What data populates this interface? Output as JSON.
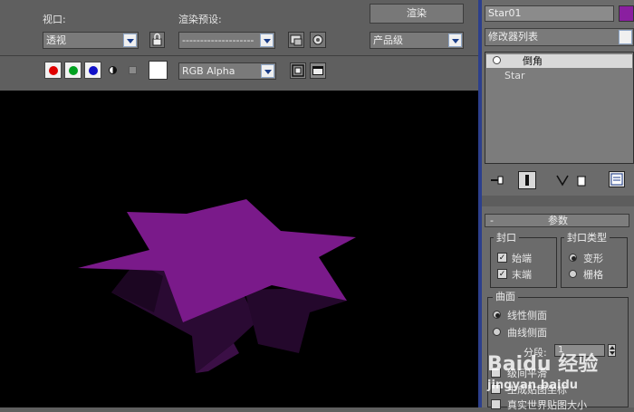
{
  "render_frame": {
    "viewport_label": "视口:",
    "viewport_value": "透视",
    "preset_label": "渲染预设:",
    "preset_value": "--------------------",
    "render_button": "渲染",
    "quality_value": "产品级",
    "channel_value": "RGB Alpha"
  },
  "command_panel": {
    "object_name": "Star01",
    "object_color": "#8a1fa0",
    "modifier_list": "修改器列表",
    "stack_items": [
      {
        "label": "倒角",
        "selected": true
      },
      {
        "label": "Star",
        "selected": false
      }
    ],
    "rollout_minus": "-",
    "rollout_title": "参数",
    "cap_group": {
      "title": "封口",
      "start": "始端",
      "end": "末端",
      "start_checked": true,
      "end_checked": true
    },
    "cap_type_group": {
      "title": "封口类型",
      "morph": "变形",
      "grid": "栅格",
      "selected": "morph"
    },
    "surface_group": {
      "title": "曲面",
      "linear": "线性侧面",
      "curved": "曲线侧面",
      "selected": "linear"
    },
    "segments_label": "分段:",
    "segments_value": "1",
    "smooth_label": "级间平滑",
    "gen_mapping_label": "生成贴图坐标",
    "real_world_label": "真实世界贴图大小"
  },
  "scene": {
    "star_color": "#7a1a8a"
  },
  "watermark": {
    "line1": "Baidu 经验",
    "line2": "jingyan.baidu"
  }
}
